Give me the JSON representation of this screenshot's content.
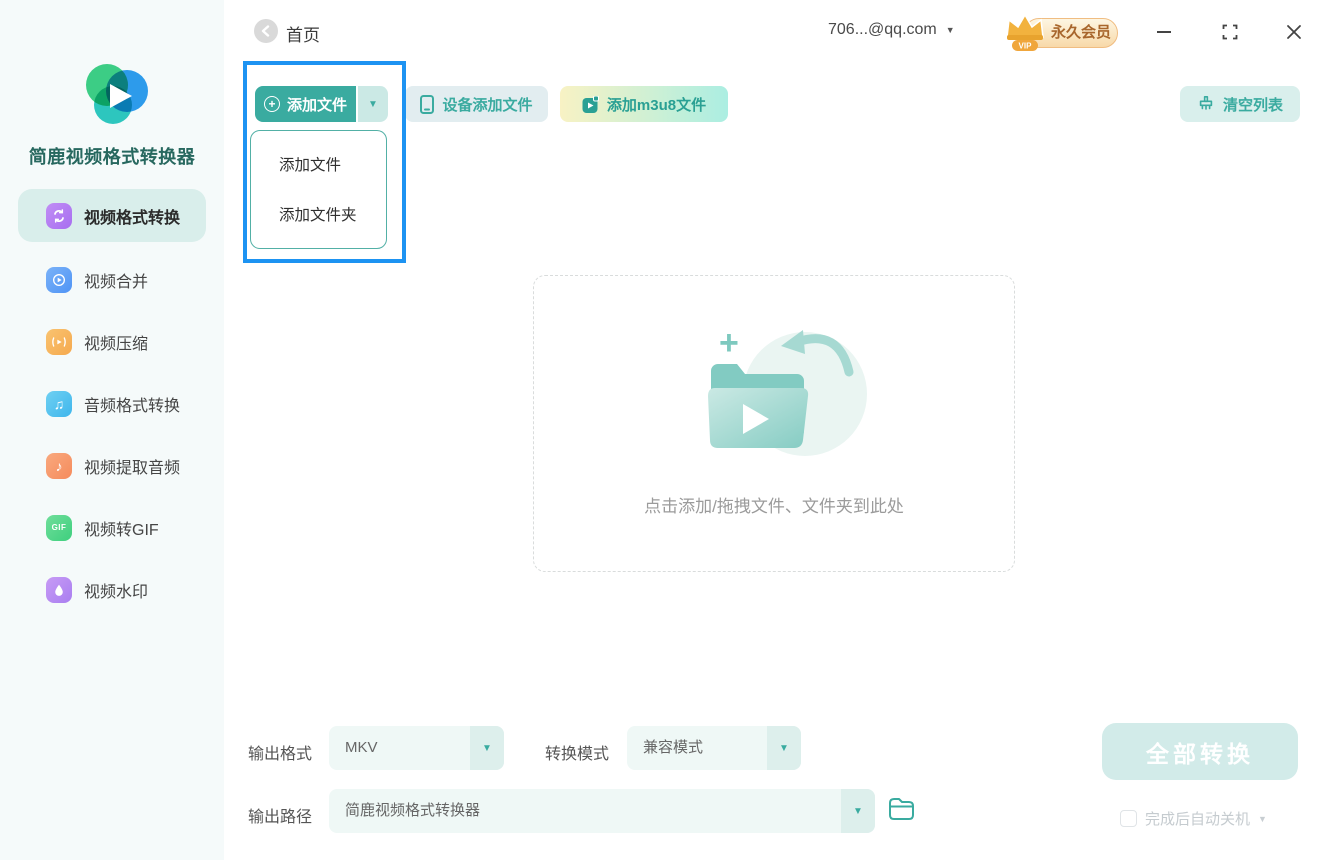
{
  "titlebar": {
    "back_label": "首页",
    "account": "706...@qq.com",
    "vip_text": "永久会员",
    "vip_small": "VIP"
  },
  "app": {
    "name": "简鹿视频格式转换器"
  },
  "sidebar": {
    "items": [
      {
        "label": "视频格式转换",
        "icon": "video-format-convert-icon",
        "active": true
      },
      {
        "label": "视频合并",
        "icon": "video-merge-icon",
        "active": false
      },
      {
        "label": "视频压缩",
        "icon": "video-compress-icon",
        "active": false
      },
      {
        "label": "音频格式转换",
        "icon": "audio-format-convert-icon",
        "active": false
      },
      {
        "label": "视频提取音频",
        "icon": "video-extract-audio-icon",
        "active": false
      },
      {
        "label": "视频转GIF",
        "icon": "video-to-gif-icon",
        "active": false
      },
      {
        "label": "视频水印",
        "icon": "video-watermark-icon",
        "active": false
      }
    ],
    "gif_icon_text": "GIF",
    "audio_note_glyph": "♫",
    "extract_note_glyph": "♪"
  },
  "toolbar": {
    "add_file": "添加文件",
    "device_add_file": "设备添加文件",
    "add_m3u8": "添加m3u8文件",
    "clear_list": "清空列表"
  },
  "add_menu": {
    "items": [
      "添加文件",
      "添加文件夹"
    ]
  },
  "dropzone": {
    "hint": "点击添加/拖拽文件、文件夹到此处"
  },
  "output_bar": {
    "format_label": "输出格式",
    "format_value": "MKV",
    "mode_label": "转换模式",
    "mode_value": "兼容模式",
    "path_label": "输出路径",
    "path_value": "简鹿视频格式转换器",
    "convert_all": "全部转换",
    "auto_shutdown": "完成后自动关机"
  },
  "colors": {
    "primary_teal": "#3aaba0",
    "sidebar_bg": "#f5fafa",
    "active_item_bg": "#d9eeeb",
    "annotation_blue": "#1d93f2",
    "vip_gold": "#f2b23e",
    "convert_disabled_bg": "#d2ebe9"
  }
}
